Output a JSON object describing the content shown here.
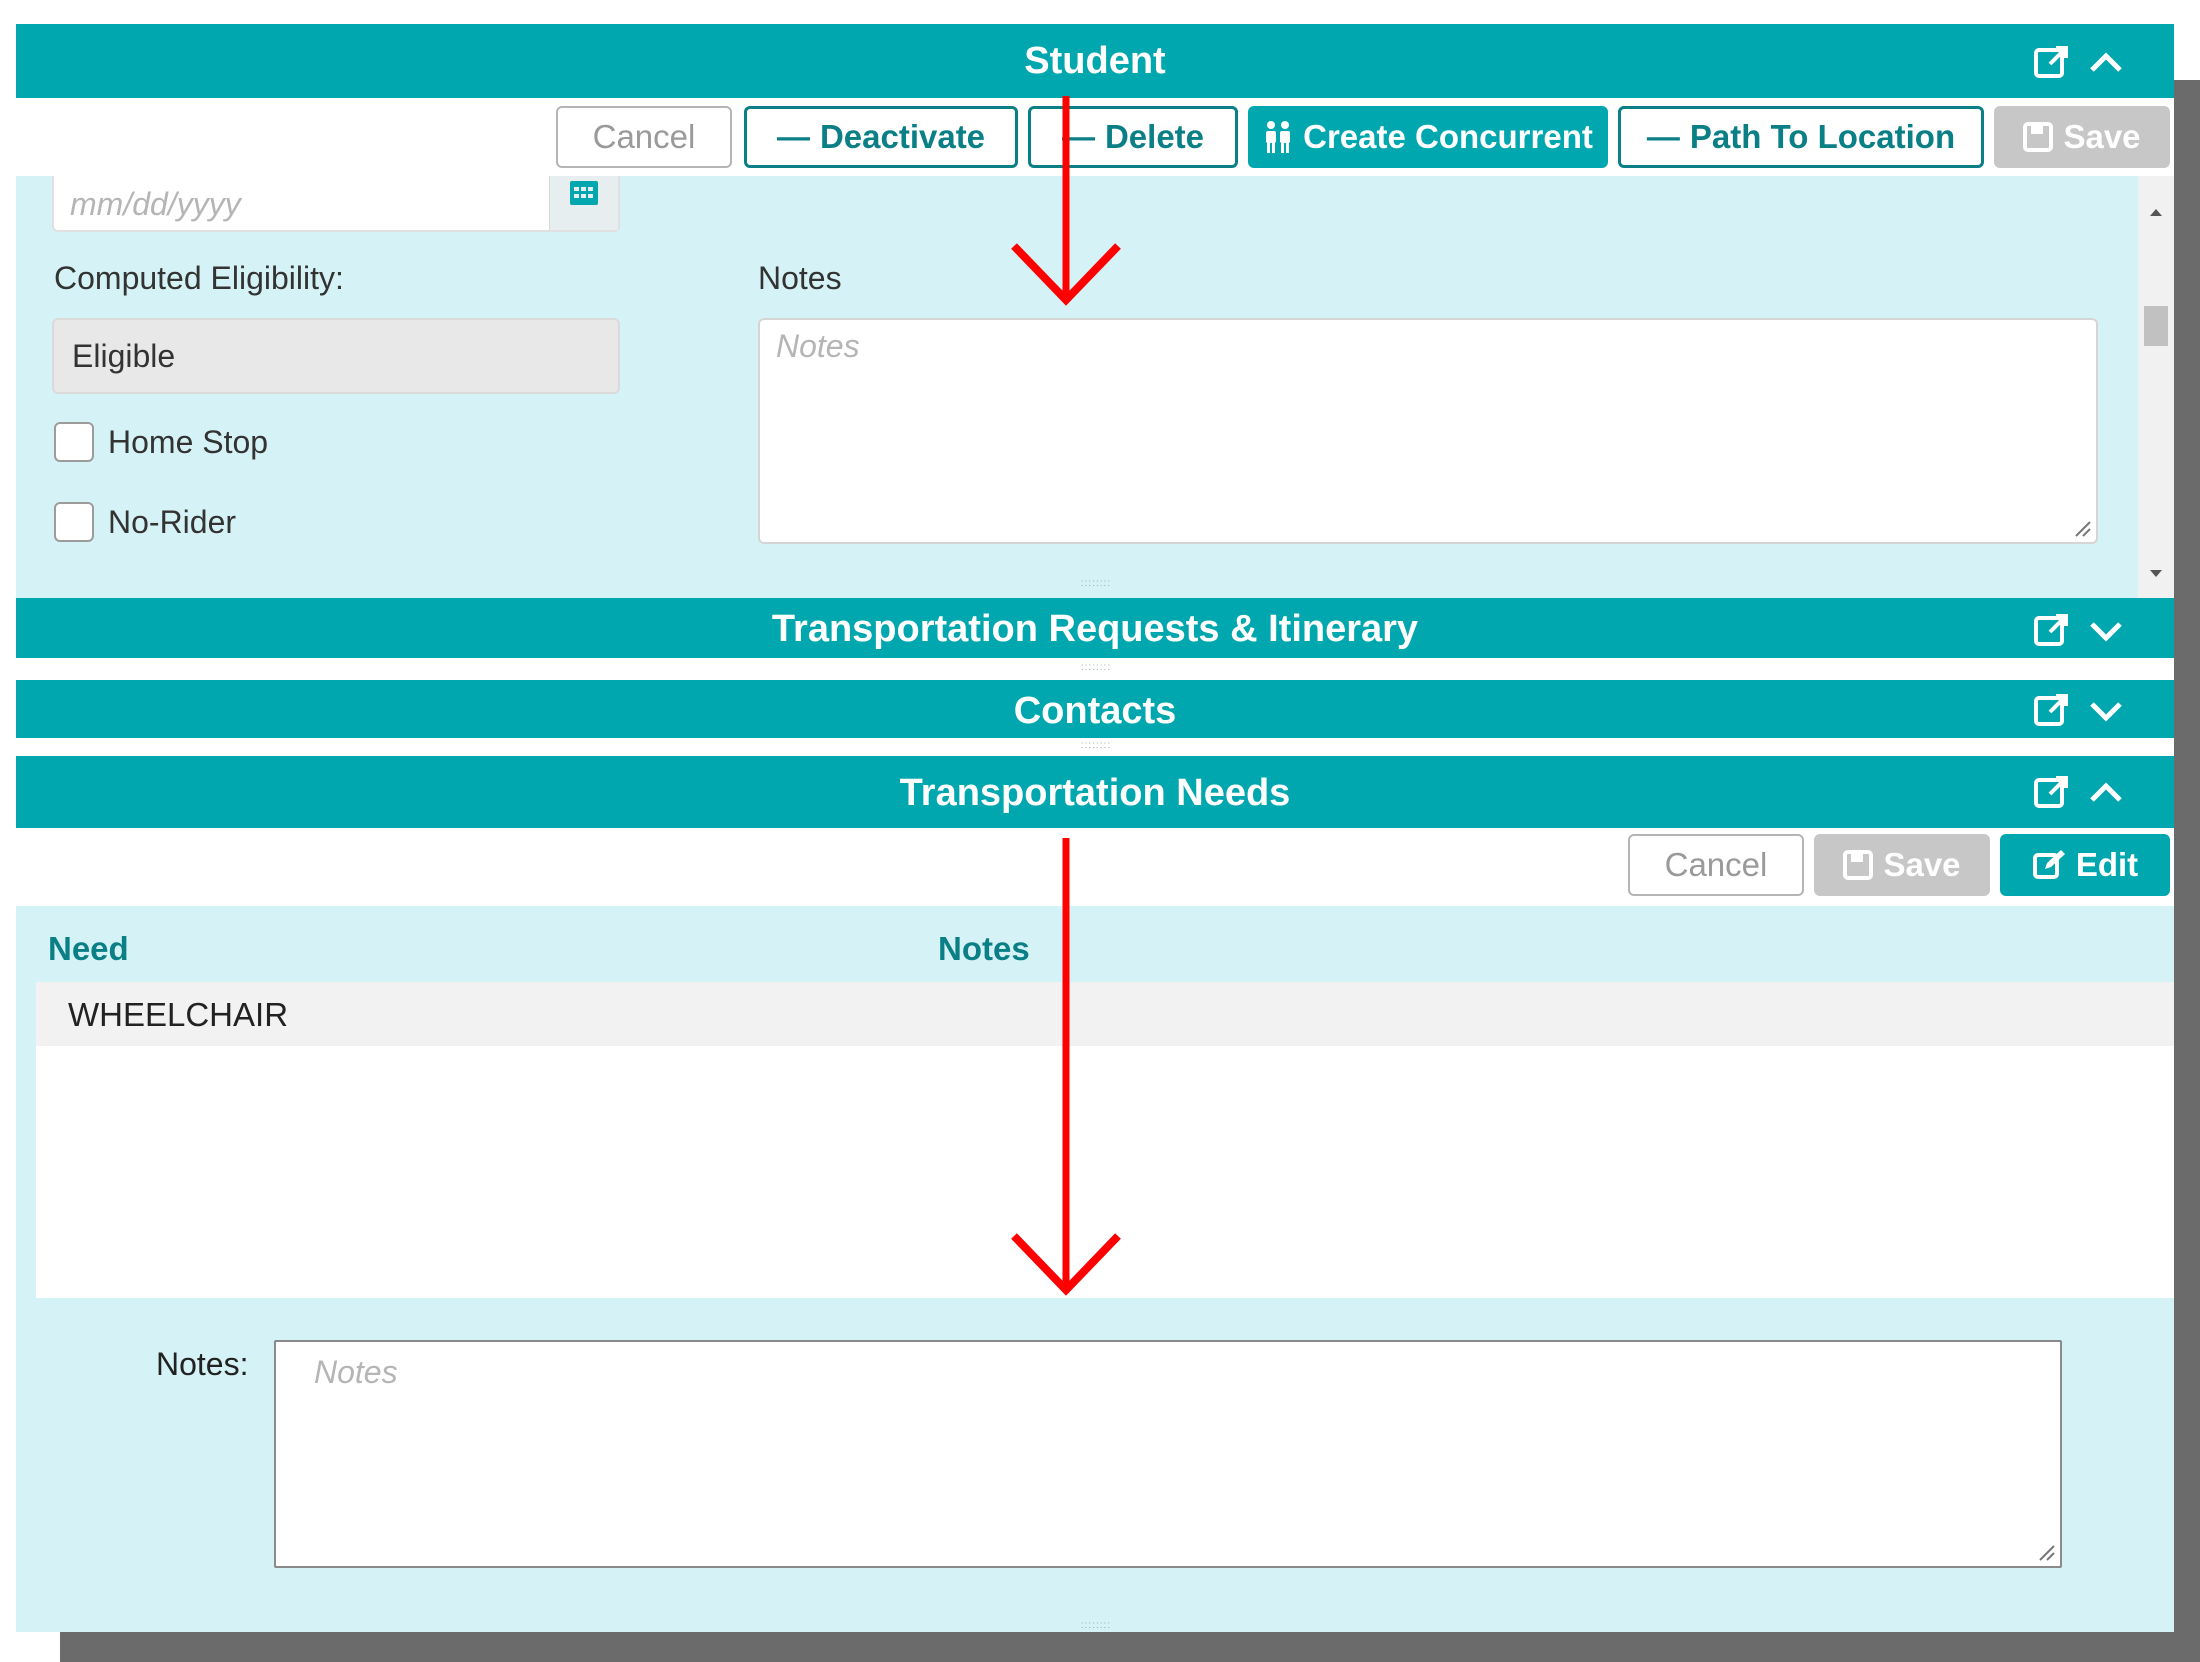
{
  "student": {
    "title": "Student",
    "toolbar": {
      "cancel": "Cancel",
      "deactivate": "Deactivate",
      "delete": "Delete",
      "create_concurrent": "Create Concurrent",
      "path_to_location": "Path To Location",
      "save": "Save"
    },
    "date_placeholder": "mm/dd/yyyy",
    "computed_eligibility_label": "Computed Eligibility:",
    "computed_eligibility_value": "Eligible",
    "home_stop_label": "Home Stop",
    "no_rider_label": "No-Rider",
    "notes_label": "Notes",
    "notes_placeholder": "Notes"
  },
  "transportation_requests": {
    "title": "Transportation Requests & Itinerary"
  },
  "contacts": {
    "title": "Contacts"
  },
  "transportation_needs": {
    "title": "Transportation Needs",
    "toolbar": {
      "cancel": "Cancel",
      "save": "Save",
      "edit": "Edit"
    },
    "columns": {
      "need": "Need",
      "notes": "Notes"
    },
    "rows": [
      {
        "need": "WHEELCHAIR",
        "notes": ""
      }
    ],
    "notes_label": "Notes:",
    "notes_placeholder": "Notes"
  },
  "colors": {
    "header": "#00a7ae",
    "panel": "#d5f3f6",
    "arrow": "#ff0000"
  }
}
